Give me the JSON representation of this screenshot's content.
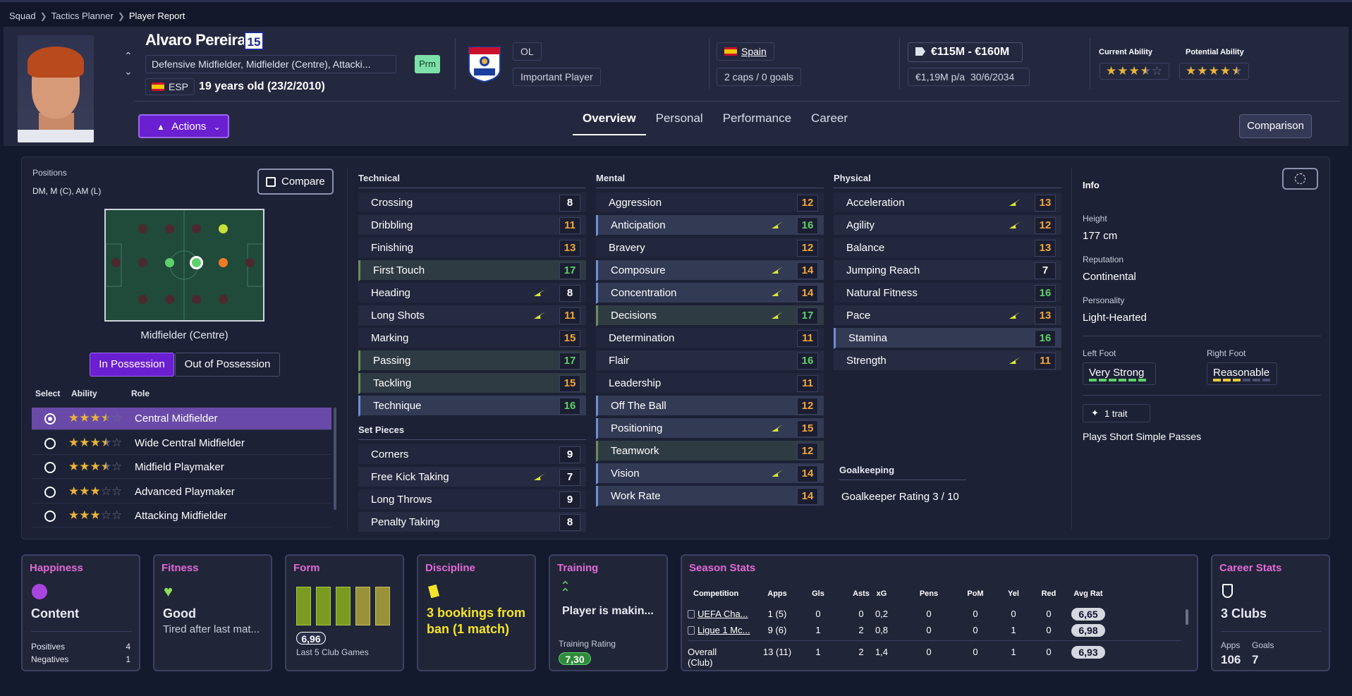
{
  "breadcrumb": [
    "Squad",
    "Tactics Planner",
    "Player Report"
  ],
  "player": {
    "name": "Alvaro Pereira",
    "number": "15",
    "positions": "Defensive Midfielder, Midfielder (Centre), Attacki...",
    "nation_code": "ESP",
    "age": "19 years old (23/2/2010)",
    "status_badge": "Prm"
  },
  "club": {
    "logo_text": "OL",
    "name": "OL",
    "role": "Important Player"
  },
  "international": {
    "country": "Spain",
    "caps": "2 caps / 0 goals"
  },
  "contract": {
    "value": "€115M - €160M",
    "wage": "€1,19M p/a",
    "expires": "30/6/2034"
  },
  "ability": {
    "current_label": "Current Ability",
    "current_stars": 3.5,
    "potential_label": "Potential Ability",
    "potential_stars": 4.5
  },
  "actions_label": "Actions",
  "tabs": [
    "Overview",
    "Personal",
    "Performance",
    "Career"
  ],
  "comparison_label": "Comparison",
  "positions_panel": {
    "label": "Positions",
    "value": "DM, M (C), AM (L)",
    "compare_label": "Compare",
    "pitch_name": "Midfielder (Centre)",
    "in_possession": "In Possession",
    "out_of_possession": "Out of Possession",
    "headers": {
      "select": "Select",
      "ability": "Ability",
      "role": "Role"
    },
    "roles": [
      {
        "name": "Central Midfielder",
        "stars": 3.5,
        "selected": true
      },
      {
        "name": "Wide Central Midfielder",
        "stars": 3.5,
        "selected": false
      },
      {
        "name": "Midfield Playmaker",
        "stars": 3.5,
        "selected": false
      },
      {
        "name": "Advanced Playmaker",
        "stars": 3,
        "selected": false
      },
      {
        "name": "Attacking Midfielder",
        "stars": 3,
        "selected": false
      }
    ]
  },
  "attributes": {
    "technical_title": "Technical",
    "technical": [
      {
        "name": "Crossing",
        "value": "8",
        "c": "white",
        "s": ""
      },
      {
        "name": "Dribbling",
        "value": "11",
        "c": "orange",
        "s": ""
      },
      {
        "name": "Finishing",
        "value": "13",
        "c": "orange",
        "s": ""
      },
      {
        "name": "First Touch",
        "value": "17",
        "c": "green",
        "s": "hl"
      },
      {
        "name": "Heading",
        "value": "8",
        "c": "white",
        "s": "",
        "f": true
      },
      {
        "name": "Long Shots",
        "value": "11",
        "c": "orange",
        "s": "",
        "f": true
      },
      {
        "name": "Marking",
        "value": "15",
        "c": "orange",
        "s": ""
      },
      {
        "name": "Passing",
        "value": "17",
        "c": "green",
        "s": "hl"
      },
      {
        "name": "Tackling",
        "value": "15",
        "c": "orange",
        "s": "hl"
      },
      {
        "name": "Technique",
        "value": "16",
        "c": "green",
        "s": "bl"
      }
    ],
    "setpieces_title": "Set Pieces",
    "setpieces": [
      {
        "name": "Corners",
        "value": "9",
        "c": "white",
        "s": ""
      },
      {
        "name": "Free Kick Taking",
        "value": "7",
        "c": "white",
        "s": "",
        "f": true
      },
      {
        "name": "Long Throws",
        "value": "9",
        "c": "white",
        "s": ""
      },
      {
        "name": "Penalty Taking",
        "value": "8",
        "c": "white",
        "s": ""
      }
    ],
    "mental_title": "Mental",
    "mental": [
      {
        "name": "Aggression",
        "value": "12",
        "c": "orange",
        "s": ""
      },
      {
        "name": "Anticipation",
        "value": "16",
        "c": "green",
        "s": "bl",
        "f": true
      },
      {
        "name": "Bravery",
        "value": "12",
        "c": "orange",
        "s": ""
      },
      {
        "name": "Composure",
        "value": "14",
        "c": "orange",
        "s": "bl",
        "f": true
      },
      {
        "name": "Concentration",
        "value": "14",
        "c": "orange",
        "s": "bl",
        "f": true
      },
      {
        "name": "Decisions",
        "value": "17",
        "c": "green",
        "s": "hl",
        "f": true
      },
      {
        "name": "Determination",
        "value": "11",
        "c": "orange",
        "s": ""
      },
      {
        "name": "Flair",
        "value": "16",
        "c": "green",
        "s": ""
      },
      {
        "name": "Leadership",
        "value": "11",
        "c": "orange",
        "s": ""
      },
      {
        "name": "Off The Ball",
        "value": "12",
        "c": "orange",
        "s": "bl"
      },
      {
        "name": "Positioning",
        "value": "15",
        "c": "orange",
        "s": "bl",
        "f": true
      },
      {
        "name": "Teamwork",
        "value": "12",
        "c": "orange",
        "s": "hl"
      },
      {
        "name": "Vision",
        "value": "14",
        "c": "orange",
        "s": "bl",
        "f": true
      },
      {
        "name": "Work Rate",
        "value": "14",
        "c": "orange",
        "s": "bl"
      }
    ],
    "physical_title": "Physical",
    "physical": [
      {
        "name": "Acceleration",
        "value": "13",
        "c": "orange",
        "s": "",
        "f": true
      },
      {
        "name": "Agility",
        "value": "12",
        "c": "orange",
        "s": "",
        "f": true
      },
      {
        "name": "Balance",
        "value": "13",
        "c": "orange",
        "s": ""
      },
      {
        "name": "Jumping Reach",
        "value": "7",
        "c": "white",
        "s": ""
      },
      {
        "name": "Natural Fitness",
        "value": "16",
        "c": "green",
        "s": ""
      },
      {
        "name": "Pace",
        "value": "13",
        "c": "orange",
        "s": "",
        "f": true
      },
      {
        "name": "Stamina",
        "value": "16",
        "c": "green",
        "s": "bl"
      },
      {
        "name": "Strength",
        "value": "11",
        "c": "orange",
        "s": "",
        "f": true
      }
    ],
    "goalkeeping_title": "Goalkeeping",
    "goalkeeper_rating": "Goalkeeper Rating  3 / 10"
  },
  "info": {
    "title": "Info",
    "height_label": "Height",
    "height": "177 cm",
    "reputation_label": "Reputation",
    "reputation": "Continental",
    "personality_label": "Personality",
    "personality": "Light-Hearted",
    "left_foot_label": "Left Foot",
    "left_foot": "Very Strong",
    "right_foot_label": "Right Foot",
    "right_foot": "Reasonable",
    "trait_count": "1 trait",
    "trait": "Plays Short Simple Passes"
  },
  "cards": {
    "happiness": {
      "title": "Happiness",
      "value": "Content",
      "positives_label": "Positives",
      "positives": "4",
      "negatives_label": "Negatives",
      "negatives": "1"
    },
    "fitness": {
      "title": "Fitness",
      "value": "Good",
      "note": "Tired after last mat..."
    },
    "form": {
      "title": "Form",
      "rating": "6,96",
      "note": "Last 5 Club Games"
    },
    "discipline": {
      "title": "Discipline",
      "value": "3 bookings from ban (1 match)"
    },
    "training": {
      "title": "Training",
      "value": "Player is makin...",
      "rating_label": "Training Rating",
      "rating": "7,30"
    },
    "season": {
      "title": "Season Stats",
      "headers": [
        "Competition",
        "Apps",
        "Gls",
        "Asts",
        "xG",
        "Pens",
        "PoM",
        "Yel",
        "Red",
        "Avg Rat"
      ],
      "rows": [
        [
          "UEFA Cha...",
          "1 (5)",
          "0",
          "0",
          "0,2",
          "0",
          "0",
          "0",
          "0",
          "6,65"
        ],
        [
          "Ligue 1 Mc...",
          "9 (6)",
          "1",
          "2",
          "0,8",
          "0",
          "0",
          "1",
          "0",
          "6,98"
        ],
        [
          "Overall (Club)",
          "13 (11)",
          "1",
          "2",
          "1,4",
          "0",
          "0",
          "1",
          "0",
          "6,93"
        ]
      ]
    },
    "career": {
      "title": "Career Stats",
      "value": "3 Clubs",
      "apps_label": "Apps",
      "apps": "106",
      "goals_label": "Goals",
      "goals": "7"
    }
  }
}
